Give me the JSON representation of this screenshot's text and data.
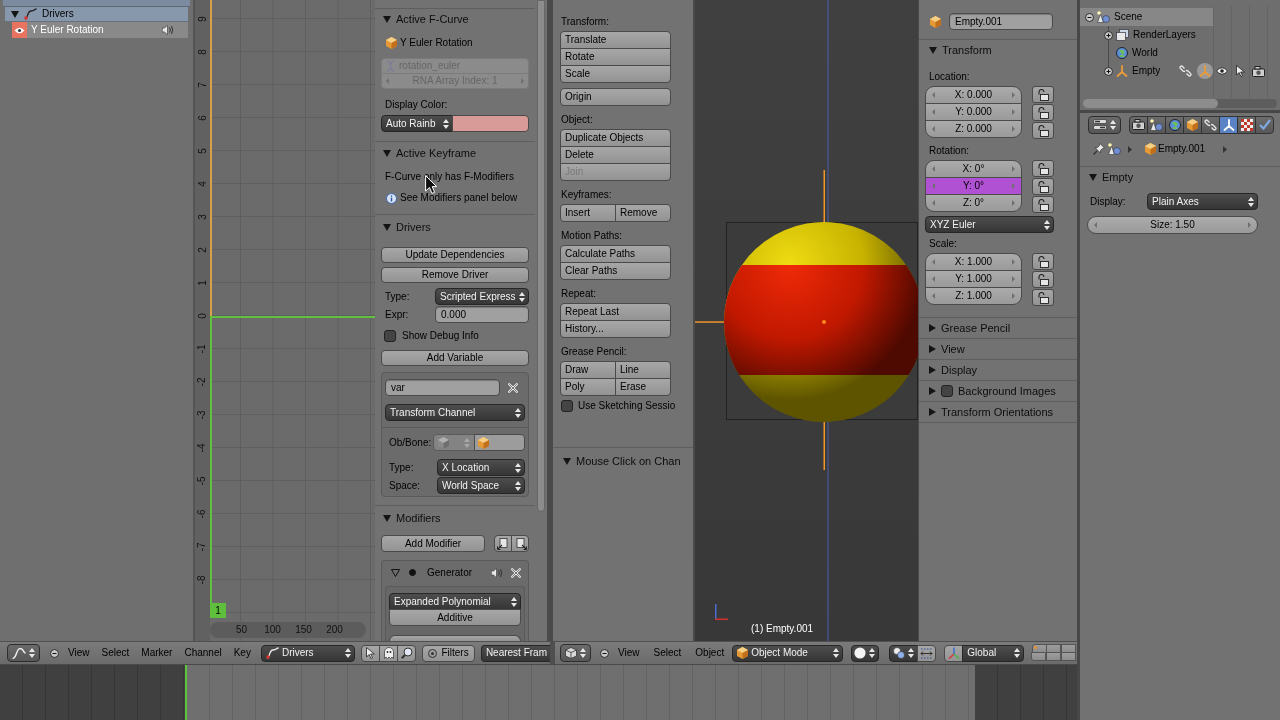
{
  "graph_editor": {
    "channels": [
      {
        "kind": "group",
        "label": "Drivers",
        "expanded": true,
        "selected": false
      },
      {
        "kind": "fcurve",
        "label": "Y Euler Rotation",
        "selected": true,
        "muted": false,
        "color": "#e8735f"
      }
    ],
    "value_ruler": [
      "9",
      "8",
      "7",
      "6",
      "5",
      "4",
      "3",
      "2",
      "1",
      "0",
      "-1",
      "-2",
      "-3",
      "-4",
      "-5",
      "-6",
      "-7",
      "-8"
    ],
    "frame_ruler": [
      "50",
      "100",
      "150",
      "200"
    ],
    "current_frame": "1",
    "sidebar": {
      "active_fcurve": {
        "title": "Active F-Curve",
        "expanded": true,
        "name": "Y Euler Rotation",
        "data_path": "rotation_euler",
        "array_index": "RNA Array Index: 1",
        "color_label": "Display Color:",
        "color_mode": "Auto Rainb",
        "color": "#d99b98"
      },
      "active_keyframe": {
        "title": "Active Keyframe",
        "expanded": true,
        "message": "F-Curve only has F-Modifiers",
        "hint": "See Modifiers panel below"
      },
      "drivers": {
        "title": "Drivers",
        "expanded": true,
        "buttons": [
          "Update Dependencies",
          "Remove Driver"
        ],
        "type_label": "Type:",
        "type": "Scripted Express",
        "expr_label": "Expr:",
        "expr": "0.000",
        "debug": {
          "label": "Show Debug Info",
          "checked": false
        },
        "add_variable": "Add Variable",
        "variable": {
          "name": "var",
          "type": "Transform Channel",
          "object_label": "Ob/Bone:",
          "transform_label": "Type:",
          "transform_type": "X Location",
          "space_label": "Space:",
          "space": "World Space"
        }
      },
      "modifiers": {
        "title": "Modifiers",
        "expanded": true,
        "add": "Add Modifier",
        "modifier": {
          "name": "Generator",
          "expanded": true,
          "active": true,
          "muted": false,
          "mode": "Expanded Polynomial",
          "additive": "Additive"
        }
      }
    },
    "header": {
      "menus": [
        "View",
        "Select",
        "Marker",
        "Channel",
        "Key"
      ],
      "mode": "Drivers",
      "filters": "Filters",
      "snap": "Nearest Fram"
    }
  },
  "view3d": {
    "tool_shelf": {
      "sections": [
        {
          "label": "Transform:",
          "rows": [
            [
              {
                "label": "Translate",
                "disabled": false
              }
            ],
            [
              {
                "label": "Rotate",
                "disabled": false
              }
            ],
            [
              {
                "label": "Scale",
                "disabled": false
              }
            ]
          ]
        },
        {
          "rows": [
            [
              {
                "label": "Origin",
                "disabled": false
              }
            ]
          ]
        },
        {
          "label": "Object:",
          "rows": [
            [
              {
                "label": "Duplicate Objects",
                "disabled": false
              }
            ],
            [
              {
                "label": "Delete",
                "disabled": false
              }
            ],
            [
              {
                "label": "Join",
                "disabled": true
              }
            ]
          ]
        },
        {
          "label": "Keyframes:",
          "rows": [
            [
              {
                "label": "Insert",
                "disabled": false
              },
              {
                "label": "Remove",
                "disabled": false
              }
            ]
          ]
        },
        {
          "label": "Motion Paths:",
          "rows": [
            [
              {
                "label": "Calculate Paths",
                "disabled": false
              }
            ],
            [
              {
                "label": "Clear Paths",
                "disabled": false
              }
            ]
          ]
        },
        {
          "label": "Repeat:",
          "rows": [
            [
              {
                "label": "Repeat Last",
                "disabled": false
              }
            ],
            [
              {
                "label": "History...",
                "disabled": false
              }
            ]
          ]
        },
        {
          "label": "Grease Pencil:",
          "rows": [
            [
              {
                "label": "Draw",
                "disabled": false
              },
              {
                "label": "Line",
                "disabled": false
              }
            ],
            [
              {
                "label": "Poly",
                "disabled": false
              },
              {
                "label": "Erase",
                "disabled": false
              }
            ]
          ]
        }
      ],
      "sketching": {
        "label": "Use Sketching Sessio",
        "checked": false
      },
      "last_operator": {
        "title": "Mouse Click on Chan",
        "expanded": true
      }
    },
    "viewport": {
      "info": "(1) Empty.001"
    },
    "sidebar": {
      "name": "Empty.001",
      "transform": {
        "title": "Transform",
        "expanded": true,
        "location_label": "Location:",
        "location": [
          {
            "value": "X: 0.000",
            "driven": false,
            "locked": false
          },
          {
            "value": "Y: 0.000",
            "driven": false,
            "locked": false
          },
          {
            "value": "Z: 0.000",
            "driven": false,
            "locked": false
          }
        ],
        "rotation_label": "Rotation:",
        "rotation": [
          {
            "value": "X: 0°",
            "driven": false,
            "locked": false
          },
          {
            "value": "Y: 0°",
            "driven": true,
            "locked": false
          },
          {
            "value": "Z: 0°",
            "driven": false,
            "locked": false
          }
        ],
        "rotation_mode": "XYZ Euler",
        "scale_label": "Scale:",
        "scale": [
          {
            "value": "X: 1.000",
            "driven": false,
            "locked": false
          },
          {
            "value": "Y: 1.000",
            "driven": false,
            "locked": false
          },
          {
            "value": "Z: 1.000",
            "driven": false,
            "locked": false
          }
        ]
      },
      "panels": [
        {
          "kind": "plain",
          "title": "Grease Pencil",
          "expanded": false
        },
        {
          "kind": "plain",
          "title": "View",
          "expanded": false
        },
        {
          "kind": "plain",
          "title": "Display",
          "expanded": false
        },
        {
          "kind": "toggle",
          "title": "Background Images",
          "expanded": false,
          "checked": false
        },
        {
          "kind": "plain",
          "title": "Transform Orientations",
          "expanded": false
        }
      ]
    },
    "header": {
      "menus": [
        "View",
        "Select",
        "Object"
      ],
      "mode": "Object Mode",
      "orientation": "Global",
      "layers": [
        {
          "used": true
        },
        {
          "used": false
        },
        {
          "used": false
        },
        {
          "used": false
        },
        {
          "used": false
        },
        {
          "used": false
        }
      ]
    }
  },
  "outliner": {
    "tree": [
      {
        "kind": "scene",
        "label": "Scene",
        "expanded": true,
        "selected": true,
        "children": [
          {
            "kind": "render_layers",
            "label": "RenderLayers",
            "expanded": false,
            "selected": false
          },
          {
            "kind": "world",
            "label": "World",
            "selected": false
          },
          {
            "kind": "empty",
            "label": "Empty",
            "expanded": false,
            "selected": false,
            "visible": true,
            "selectable": true,
            "renderable": true
          }
        ]
      }
    ]
  },
  "properties": {
    "tabs": [
      {
        "kind": "render",
        "selected": false
      },
      {
        "kind": "scene",
        "selected": false
      },
      {
        "kind": "world",
        "selected": false
      },
      {
        "kind": "object",
        "selected": false
      },
      {
        "kind": "constraints",
        "selected": false
      },
      {
        "kind": "data",
        "selected": true
      },
      {
        "kind": "texture",
        "selected": false
      },
      {
        "kind": "physics",
        "selected": false
      }
    ],
    "breadcrumb": "Empty.001",
    "panel": {
      "title": "Empty",
      "expanded": true,
      "display_label": "Display:",
      "display": "Plain Axes",
      "size": "Size: 1.50"
    }
  }
}
